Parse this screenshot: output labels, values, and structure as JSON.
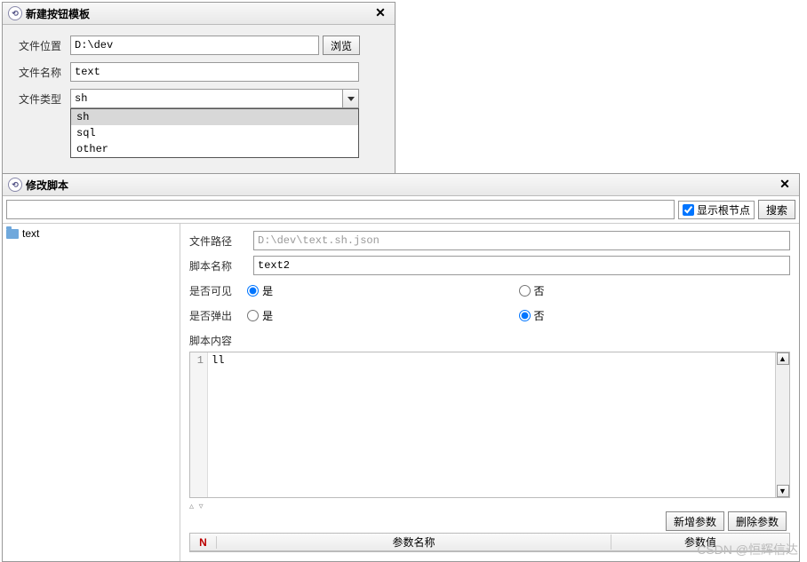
{
  "dialog1": {
    "title": "新建按钮模板",
    "rows": {
      "location": {
        "label": "文件位置",
        "value": "D:\\dev",
        "browse": "浏览"
      },
      "name": {
        "label": "文件名称",
        "value": "text"
      },
      "type": {
        "label": "文件类型",
        "value": "sh"
      }
    },
    "dropdown": [
      "sh",
      "sql",
      "other"
    ]
  },
  "dialog2": {
    "title": "修改脚本",
    "showRoot": "显示根节点",
    "search": "搜索",
    "tree": {
      "root": "text"
    },
    "form": {
      "path": {
        "label": "文件路径",
        "value": "D:\\dev\\text.sh.json"
      },
      "scriptName": {
        "label": "脚本名称",
        "value": "text2"
      },
      "visible": {
        "label": "是否可见",
        "yes": "是",
        "no": "否"
      },
      "popup": {
        "label": "是否弹出",
        "yes": "是",
        "no": "否"
      },
      "content": {
        "label": "脚本内容",
        "lineNo": "1",
        "code": "ll"
      }
    },
    "paramButtons": {
      "add": "新增参数",
      "del": "删除参数"
    },
    "paramCols": {
      "n": "N",
      "name": "参数名称",
      "val": "参数值"
    }
  },
  "watermark": "CSDN @恒辉信达"
}
